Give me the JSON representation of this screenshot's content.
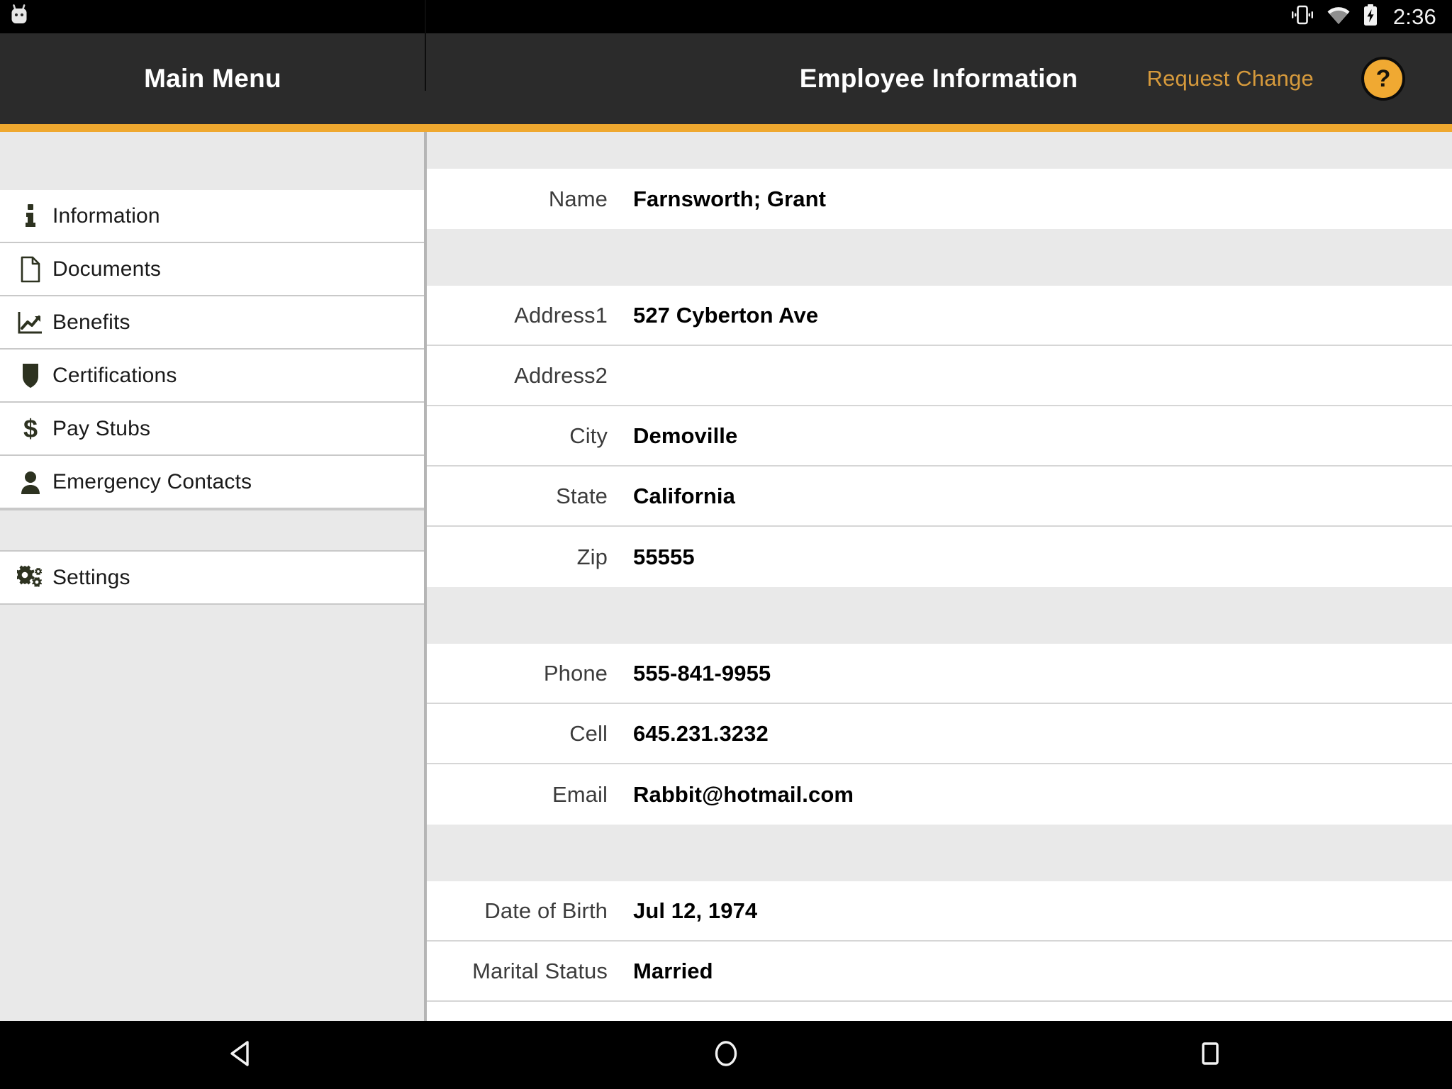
{
  "status_bar": {
    "notification_icon": "android-robot-icon",
    "icons": [
      "vibrate-icon",
      "wifi-icon",
      "battery-charging-icon"
    ],
    "clock": "2:36"
  },
  "app_bar": {
    "menu_title": "Main Menu",
    "page_title": "Employee Information",
    "request_change_label": "Request Change",
    "help_label": "?",
    "accent_color": "#efa82f",
    "bar_color": "#2b2b2b",
    "link_color": "#d69a3c"
  },
  "sidebar": {
    "items": [
      {
        "label": "Information",
        "icon": "info-icon"
      },
      {
        "label": "Documents",
        "icon": "document-icon"
      },
      {
        "label": "Benefits",
        "icon": "chart-line-icon"
      },
      {
        "label": "Certifications",
        "icon": "shield-icon"
      },
      {
        "label": "Pay Stubs",
        "icon": "dollar-icon"
      },
      {
        "label": "Emergency Contacts",
        "icon": "person-icon"
      }
    ],
    "settings": {
      "label": "Settings",
      "icon": "gears-icon"
    },
    "icon_color": "#2d3220"
  },
  "content": {
    "groups": [
      {
        "rows": [
          {
            "label": "Name",
            "value": "Farnsworth; Grant"
          }
        ]
      },
      {
        "rows": [
          {
            "label": "Address1",
            "value": "527 Cyberton Ave"
          },
          {
            "label": "Address2",
            "value": ""
          },
          {
            "label": "City",
            "value": "Demoville"
          },
          {
            "label": "State",
            "value": "California"
          },
          {
            "label": "Zip",
            "value": "55555"
          }
        ]
      },
      {
        "rows": [
          {
            "label": "Phone",
            "value": "555-841-9955"
          },
          {
            "label": "Cell",
            "value": "645.231.3232"
          },
          {
            "label": "Email",
            "value": "Rabbit@hotmail.com"
          }
        ]
      },
      {
        "rows": [
          {
            "label": "Date of Birth",
            "value": "Jul 12, 1974"
          },
          {
            "label": "Marital Status",
            "value": "Married"
          }
        ]
      }
    ]
  },
  "nav_bar": {
    "buttons": [
      {
        "name": "back-button",
        "icon": "triangle-left-icon"
      },
      {
        "name": "home-button",
        "icon": "circle-icon"
      },
      {
        "name": "recents-button",
        "icon": "square-icon"
      }
    ]
  }
}
